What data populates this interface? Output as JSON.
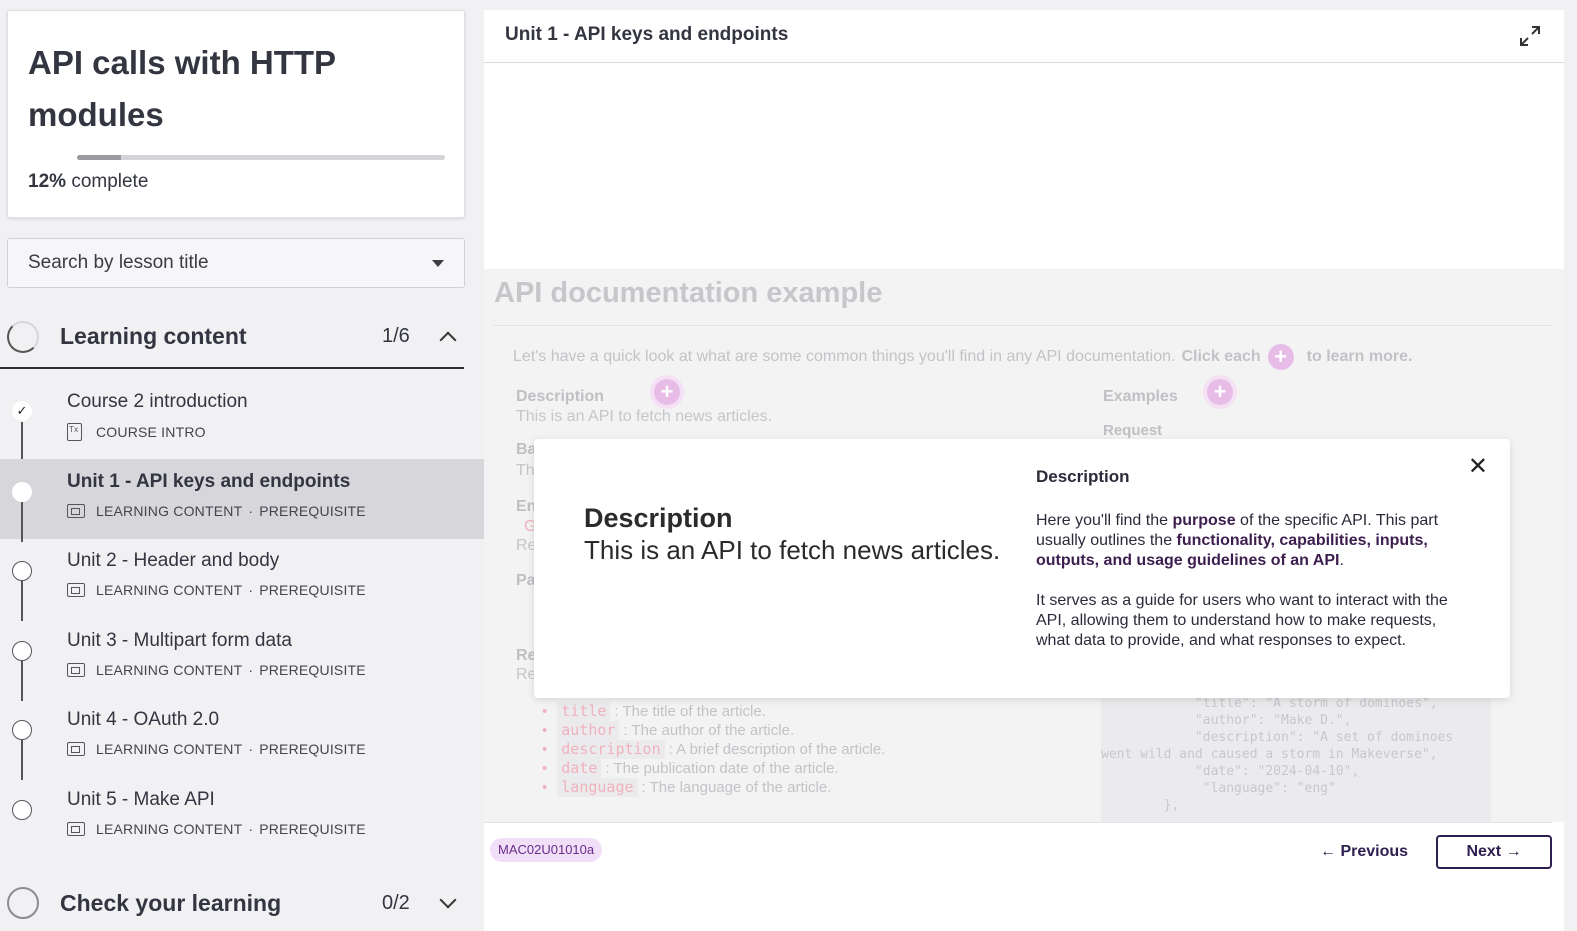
{
  "course": {
    "title": "API calls with HTTP modules",
    "progress_percent": 12,
    "progress_pct_text": "12%",
    "progress_suffix": "complete"
  },
  "search": {
    "placeholder": "Search by lesson title"
  },
  "sections": [
    {
      "title": "Learning content",
      "count": "1/6",
      "expanded": true,
      "lessons": [
        {
          "title": "Course 2 introduction",
          "type": "COURSE INTRO",
          "tag": "",
          "status": "completed"
        },
        {
          "title": "Unit 1 - API keys and endpoints",
          "type": "LEARNING CONTENT",
          "tag": "PREREQUISITE",
          "status": "active"
        },
        {
          "title": "Unit 2 - Header and body",
          "type": "LEARNING CONTENT",
          "tag": "PREREQUISITE",
          "status": "todo"
        },
        {
          "title": "Unit 3 - Multipart form data",
          "type": "LEARNING CONTENT",
          "tag": "PREREQUISITE",
          "status": "todo"
        },
        {
          "title": "Unit 4 - OAuth 2.0",
          "type": "LEARNING CONTENT",
          "tag": "PREREQUISITE",
          "status": "todo"
        },
        {
          "title": "Unit 5 - Make API",
          "type": "LEARNING CONTENT",
          "tag": "PREREQUISITE",
          "status": "todo"
        }
      ]
    },
    {
      "title": "Check your learning",
      "count": "0/2",
      "expanded": false
    }
  ],
  "main": {
    "title": "Unit 1 - API keys and endpoints",
    "doc": {
      "heading": "API documentation example",
      "intro": "Let's have a quick look at what are some common things you'll find in any API documentation.",
      "intro_bold_a": "Click each",
      "intro_bold_b": "to learn more.",
      "description_label": "Description",
      "description_text": "This is an API to fetch news articles.",
      "examples_label": "Examples",
      "request_label": "Request",
      "left_partials": [
        "Ba",
        "Th",
        "En",
        "G",
        "Re",
        "Pa",
        "Re",
        "Re"
      ],
      "fields": [
        {
          "code": "title",
          "text": ": The title of the article."
        },
        {
          "code": "author",
          "text": ": The author of the article."
        },
        {
          "code": "description",
          "text": ": A brief description of the article."
        },
        {
          "code": "date",
          "text": ": The publication date of the article."
        },
        {
          "code": "language",
          "text": ": The language of the article."
        }
      ],
      "code_lines": [
        "            \"title\": \"A storm of dominoes\",",
        "            \"author\": \"Make D.\",",
        "            \"description\": \"A set of dominoes",
        "went wild and caused a storm in Makeverse\",",
        "            \"date\": \"2024-04-10\",",
        "             \"language\": \"eng\"",
        "        },"
      ]
    },
    "modal": {
      "left_title": "Description",
      "left_text": "This is an API to fetch news articles.",
      "right_title": "Description",
      "p1_a": "Here you'll find the ",
      "p1_b": "purpose",
      "p1_c": " of the specific API. This part usually outlines the ",
      "p1_d": "functionality, capabilities, inputs, outputs, and usage guidelines of an API",
      "p1_e": ".",
      "p2": "It serves as a guide for users who want to interact with the API, allowing them to understand how to make requests, what data to provide, and what responses to expect."
    },
    "footer": {
      "code_chip": "MAC02U01010a",
      "prev_label": "← Previous",
      "next_label": "Next →"
    }
  }
}
